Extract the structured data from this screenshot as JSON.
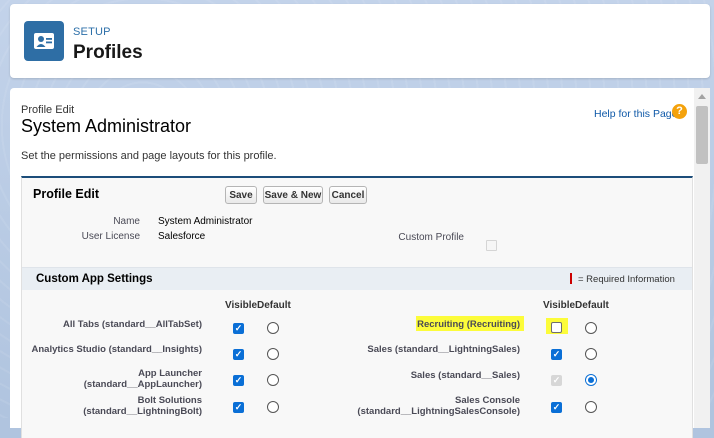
{
  "header": {
    "kicker": "SETUP",
    "title": "Profiles"
  },
  "profile": {
    "kicker": "Profile Edit",
    "title": "System Administrator",
    "help_link": "Help for this Page",
    "intro": "Set the permissions and page layouts for this profile."
  },
  "block": {
    "title": "Profile Edit",
    "buttons": {
      "save": "Save",
      "save_new": "Save & New",
      "cancel": "Cancel"
    },
    "fields": {
      "name_label": "Name",
      "name_value": "System Administrator",
      "license_label": "User License",
      "license_value": "Salesforce",
      "custom_label": "Custom Profile"
    }
  },
  "section": {
    "title": "Custom App Settings",
    "required_info": "= Required Information",
    "col_visible": "Visible",
    "col_default": "Default"
  },
  "apps_left": [
    {
      "label": "All Tabs (standard__AllTabSet)",
      "visible": true,
      "default": false
    },
    {
      "label": "Analytics Studio (standard__Insights)",
      "visible": true,
      "default": false
    },
    {
      "label_line1": "App Launcher",
      "label_line2": "(standard__AppLauncher)",
      "visible": true,
      "default": false
    },
    {
      "label_line1": "Bolt Solutions",
      "label_line2": "(standard__LightningBolt)",
      "visible": true,
      "default": false
    }
  ],
  "apps_right": [
    {
      "label": "Recruiting (Recruiting)",
      "visible": false,
      "default": false,
      "highlighted": true
    },
    {
      "label": "Sales (standard__LightningSales)",
      "visible": true,
      "default": false
    },
    {
      "label": "Sales (standard__Sales)",
      "visible": true,
      "visible_disabled": true,
      "default": true
    },
    {
      "label_line1": "Sales Console",
      "label_line2": "(standard__LightningSalesConsole)",
      "visible": true,
      "default": false
    }
  ],
  "colors": {
    "accent": "#0a6fd6",
    "header_icon": "#2e6ea5",
    "highlight": "#fcfc3a"
  },
  "icons": {
    "header": "user-profile-icon",
    "help": "help-icon"
  }
}
